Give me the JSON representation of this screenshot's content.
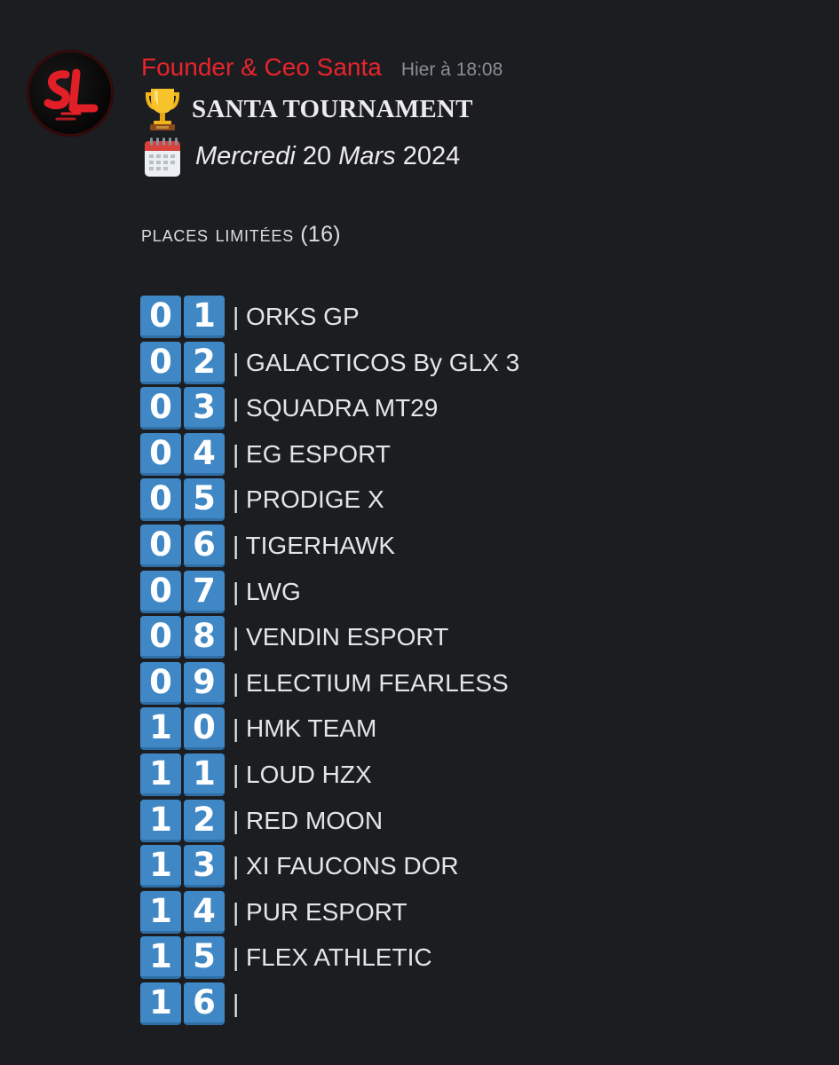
{
  "message": {
    "author": "Founder & Ceo Santa",
    "timestamp": "Hier à 18:08",
    "author_color": "#e8242c",
    "avatar": {
      "text": "SL",
      "icon": "sl-logo"
    },
    "title_emoji": "trophy-icon",
    "title": "SANTA TOURNAMENT",
    "date_emoji": "calendar-icon",
    "date": {
      "weekday": "Mercredi",
      "day": " 20 ",
      "month": " Mars",
      "year": " 2024"
    },
    "places_label": "places limitées",
    "places_count": " (16)"
  },
  "slots": [
    {
      "d1": "0",
      "d2": "1",
      "team": "| ORKS GP"
    },
    {
      "d1": "0",
      "d2": "2",
      "team": "| GALACTICOS By GLX 3"
    },
    {
      "d1": "0",
      "d2": "3",
      "team": "| SQUADRA MT29"
    },
    {
      "d1": "0",
      "d2": "4",
      "team": "| EG ESPORT"
    },
    {
      "d1": "0",
      "d2": "5",
      "team": "| PRODIGE X"
    },
    {
      "d1": "0",
      "d2": "6",
      "team": "| TIGERHAWK"
    },
    {
      "d1": "0",
      "d2": "7",
      "team": "| LWG"
    },
    {
      "d1": "0",
      "d2": "8",
      "team": "| VENDIN ESPORT"
    },
    {
      "d1": "0",
      "d2": "9",
      "team": "| ELECTIUM FEARLESS"
    },
    {
      "d1": "1",
      "d2": "0",
      "team": "| HMK TEAM"
    },
    {
      "d1": "1",
      "d2": "1",
      "team": "| LOUD HZX"
    },
    {
      "d1": "1",
      "d2": "2",
      "team": "| RED MOON"
    },
    {
      "d1": "1",
      "d2": "3",
      "team": "| XI FAUCONS DOR"
    },
    {
      "d1": "1",
      "d2": "4",
      "team": "| PUR ESPORT"
    },
    {
      "d1": "1",
      "d2": "5",
      "team": "| FLEX ATHLETIC"
    },
    {
      "d1": "1",
      "d2": "6",
      "team": "|"
    }
  ],
  "colors": {
    "background": "#1c1d21",
    "keycap": "#3f88c5",
    "timestamp": "#8b8e97"
  }
}
